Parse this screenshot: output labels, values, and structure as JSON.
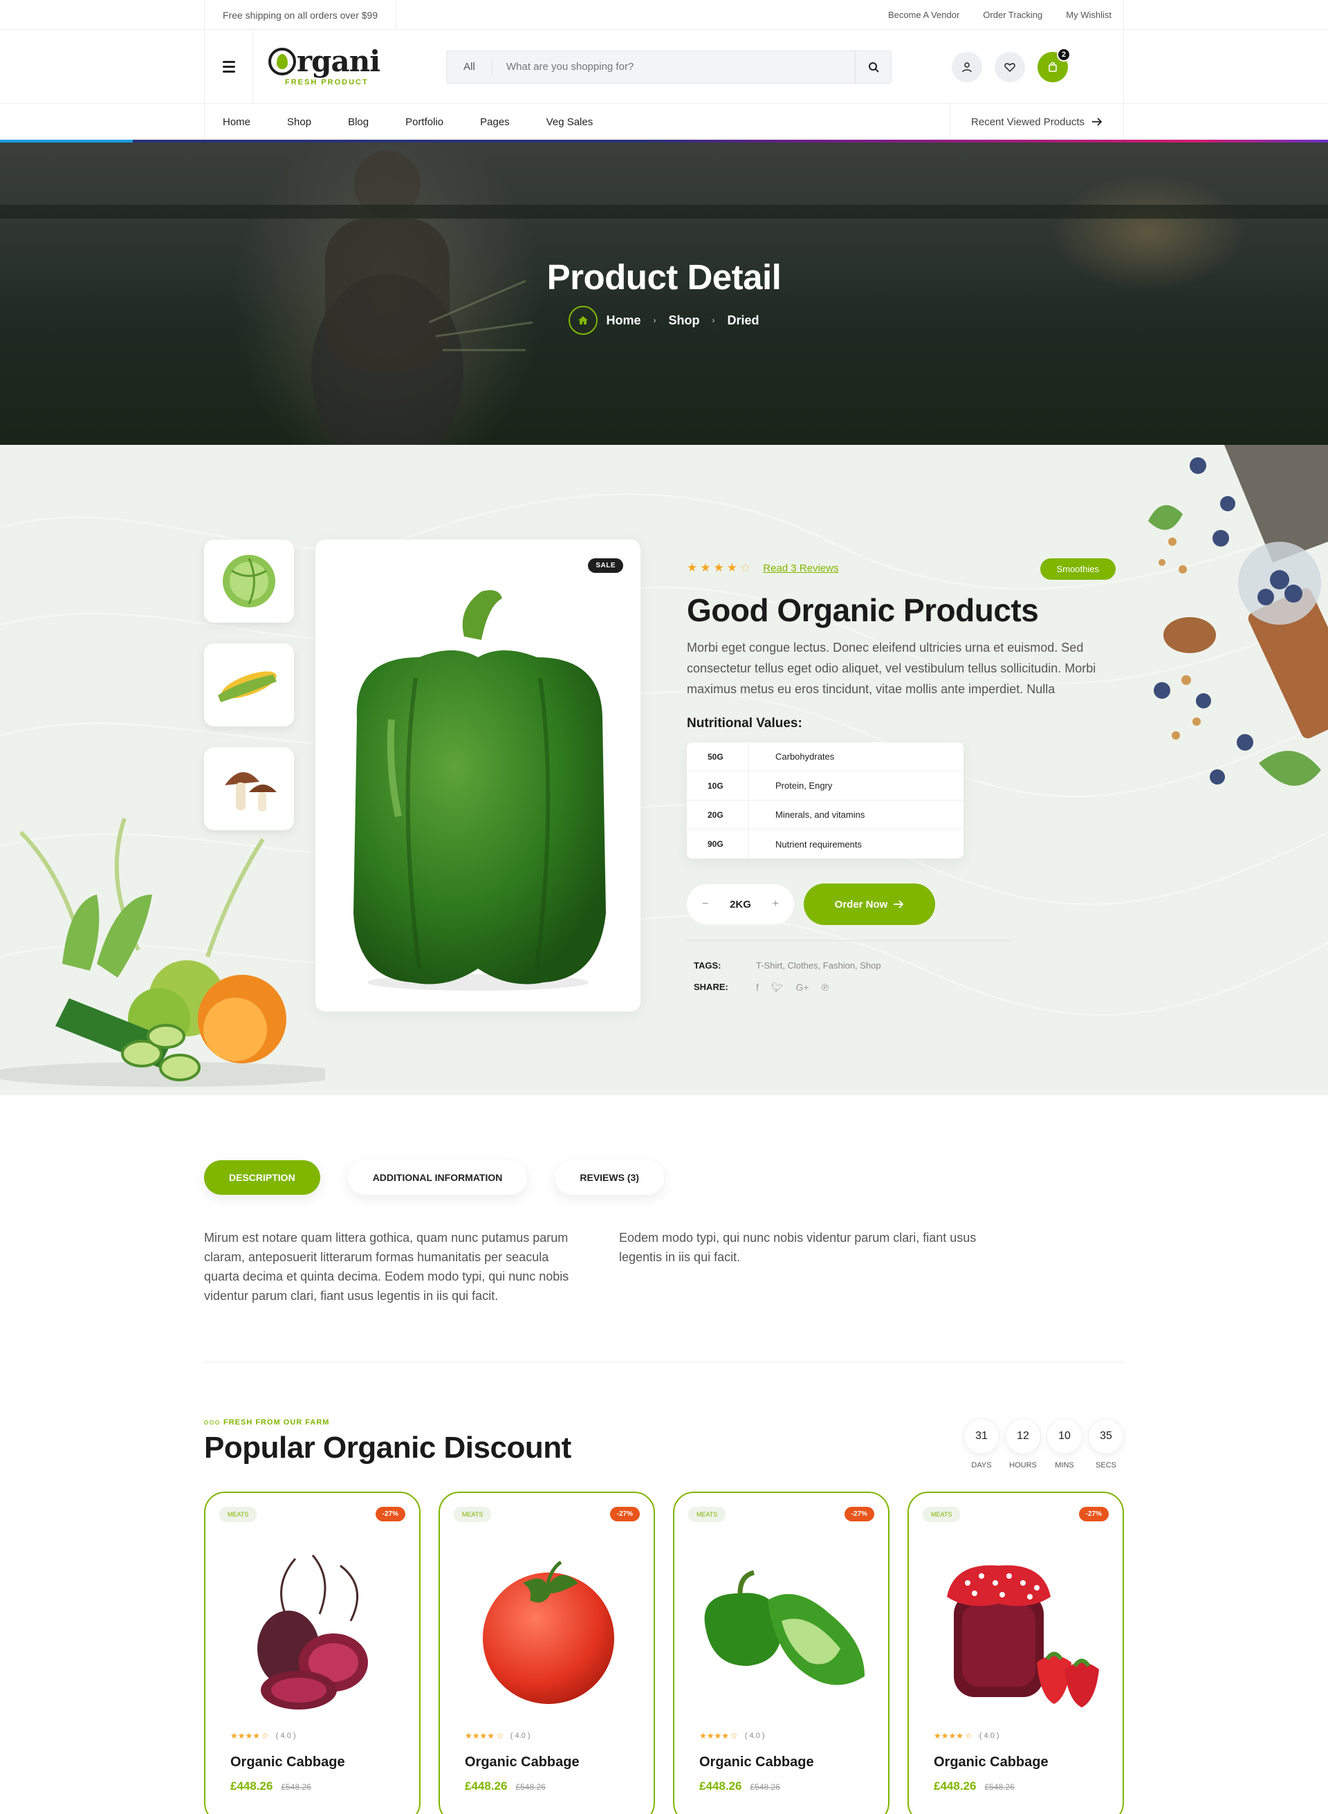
{
  "topbar": {
    "shipping": "Free shipping on all orders over $99",
    "links": [
      "Become A Vendor",
      "Order Tracking",
      "My Wishlist"
    ]
  },
  "header": {
    "logo_name": "rgani",
    "logo_tagline": "FRESH PRODUCT",
    "search_category": "All",
    "search_placeholder": "What are you shopping for?",
    "cart_count": "2"
  },
  "nav": {
    "items": [
      "Home",
      "Shop",
      "Blog",
      "Portfolio",
      "Pages",
      "Veg Sales"
    ],
    "recent": "Recent Viewed Products"
  },
  "hero": {
    "title": "Product Detail",
    "breadcrumb": [
      "Home",
      "Shop",
      "Dried"
    ]
  },
  "product": {
    "sale_badge": "SALE",
    "rating": 3.5,
    "reviews_link": "Read 3 Reviews",
    "category_pill": "Smoothies",
    "title": "Good Organic Products",
    "description": "Morbi eget congue lectus. Donec eleifend ultricies urna et euismod. Sed consectetur tellus eget odio aliquet, vel vestibulum tellus sollicitudin. Morbi maximus metus eu eros tincidunt, vitae mollis ante imperdiet. Nulla",
    "nutrition_heading": "Nutritional Values:",
    "nutrition": [
      {
        "value": "50G",
        "label": "Carbohydrates"
      },
      {
        "value": "10G",
        "label": "Protein, Engry"
      },
      {
        "value": "20G",
        "label": " Minerals, and vitamins"
      },
      {
        "value": "90G",
        "label": "Nutrient requirements"
      }
    ],
    "quantity": "2KG",
    "qty_minus": "−",
    "qty_plus": "+",
    "order_label": "Order Now",
    "tags_key": "TAGS:",
    "tags_value": "T-Shirt, Clothes, Fashion, Shop",
    "share_key": "SHARE:"
  },
  "tabs": {
    "items": [
      "DESCRIPTION",
      "ADDITIONAL INFORMATION",
      "REVIEWS (3)"
    ],
    "text_left": "Mirum est notare quam littera gothica, quam nunc putamus parum claram, anteposuerit litterarum formas humanitatis per seacula quarta decima et quinta decima. Eodem modo typi, qui nunc nobis videntur parum clari, fiant usus legentis in iis qui facit.",
    "text_right": "Eodem modo typi, qui nunc nobis videntur parum clari, fiant usus legentis in iis qui facit."
  },
  "discount": {
    "subtitle": "FRESH FROM OUR FARM",
    "title": "Popular Organic Discount",
    "timer": [
      {
        "num": "31",
        "label": "DAYS"
      },
      {
        "num": "12",
        "label": "HOURS"
      },
      {
        "num": "10",
        "label": "MINS"
      },
      {
        "num": "35",
        "label": "SECS"
      }
    ],
    "cards": [
      {
        "category": "MEATS",
        "off": "-27%",
        "rating": "( 4.0 )",
        "title": "Organic Cabbage",
        "price": "£448.26",
        "old": "£548.26",
        "image": "beetroot"
      },
      {
        "category": "MEATS",
        "off": "-27%",
        "rating": "( 4.0 )",
        "title": "Organic Cabbage",
        "price": "£448.26",
        "old": "£548.26",
        "image": "tomato"
      },
      {
        "category": "MEATS",
        "off": "-27%",
        "rating": "( 4.0 )",
        "title": "Organic Cabbage",
        "price": "£448.26",
        "old": "£548.26",
        "image": "green-pepper"
      },
      {
        "category": "MEATS",
        "off": "-27%",
        "rating": "( 4.0 )",
        "title": "Organic Cabbage",
        "price": "£448.26",
        "old": "£548.26",
        "image": "jam-jar"
      }
    ]
  },
  "colors": {
    "accent": "#80b500",
    "sale_red": "#e8541b",
    "dark": "#1a1a1a"
  }
}
